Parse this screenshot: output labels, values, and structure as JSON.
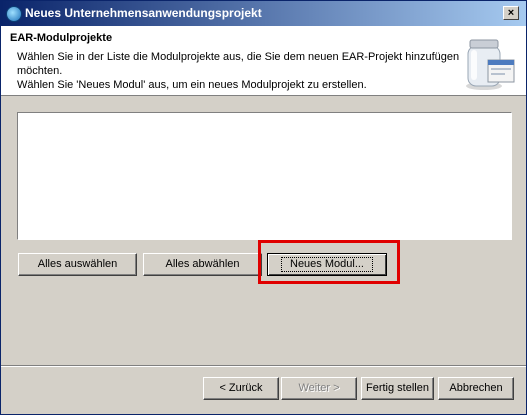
{
  "window": {
    "title": "Neues Unternehmensanwendungsprojekt",
    "close_label": "×"
  },
  "header": {
    "title": "EAR-Modulprojekte",
    "description_lines": [
      "Wählen Sie in der Liste die Modulprojekte aus, die Sie dem neuen EAR-Projekt hinzufügen",
      "möchten.",
      "Wählen Sie 'Neues Modul' aus, um ein neues Modulprojekt zu erstellen."
    ],
    "icon": "jar-icon"
  },
  "module_list": {
    "items": []
  },
  "list_buttons": {
    "select_all": "Alles auswählen",
    "deselect_all": "Alles abwählen",
    "new_module": "Neues Modul..."
  },
  "nav_buttons": {
    "back": "< Zurück",
    "next": "Weiter >",
    "finish": "Fertig stellen",
    "cancel": "Abbrechen"
  },
  "colors": {
    "highlight": "#e00000",
    "titlebar_start": "#0a246a",
    "titlebar_end": "#a6caf0"
  }
}
